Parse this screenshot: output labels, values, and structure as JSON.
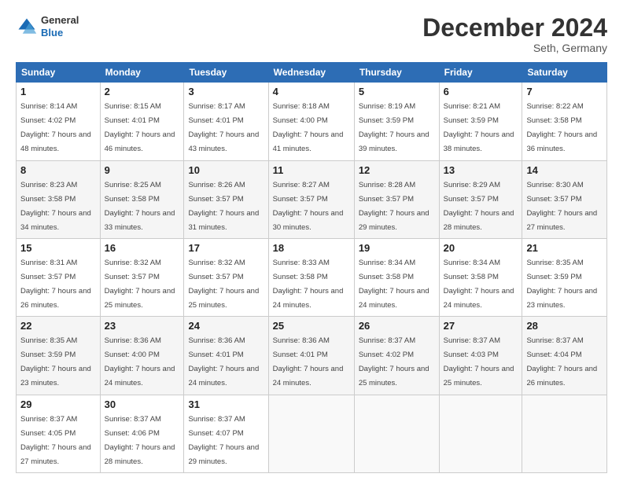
{
  "header": {
    "logo": {
      "general": "General",
      "blue": "Blue"
    },
    "month": "December 2024",
    "location": "Seth, Germany"
  },
  "weekdays": [
    "Sunday",
    "Monday",
    "Tuesday",
    "Wednesday",
    "Thursday",
    "Friday",
    "Saturday"
  ],
  "weeks": [
    [
      {
        "day": "1",
        "sunrise": "8:14 AM",
        "sunset": "4:02 PM",
        "daylight": "7 hours and 48 minutes."
      },
      {
        "day": "2",
        "sunrise": "8:15 AM",
        "sunset": "4:01 PM",
        "daylight": "7 hours and 46 minutes."
      },
      {
        "day": "3",
        "sunrise": "8:17 AM",
        "sunset": "4:01 PM",
        "daylight": "7 hours and 43 minutes."
      },
      {
        "day": "4",
        "sunrise": "8:18 AM",
        "sunset": "4:00 PM",
        "daylight": "7 hours and 41 minutes."
      },
      {
        "day": "5",
        "sunrise": "8:19 AM",
        "sunset": "3:59 PM",
        "daylight": "7 hours and 39 minutes."
      },
      {
        "day": "6",
        "sunrise": "8:21 AM",
        "sunset": "3:59 PM",
        "daylight": "7 hours and 38 minutes."
      },
      {
        "day": "7",
        "sunrise": "8:22 AM",
        "sunset": "3:58 PM",
        "daylight": "7 hours and 36 minutes."
      }
    ],
    [
      {
        "day": "8",
        "sunrise": "8:23 AM",
        "sunset": "3:58 PM",
        "daylight": "7 hours and 34 minutes."
      },
      {
        "day": "9",
        "sunrise": "8:25 AM",
        "sunset": "3:58 PM",
        "daylight": "7 hours and 33 minutes."
      },
      {
        "day": "10",
        "sunrise": "8:26 AM",
        "sunset": "3:57 PM",
        "daylight": "7 hours and 31 minutes."
      },
      {
        "day": "11",
        "sunrise": "8:27 AM",
        "sunset": "3:57 PM",
        "daylight": "7 hours and 30 minutes."
      },
      {
        "day": "12",
        "sunrise": "8:28 AM",
        "sunset": "3:57 PM",
        "daylight": "7 hours and 29 minutes."
      },
      {
        "day": "13",
        "sunrise": "8:29 AM",
        "sunset": "3:57 PM",
        "daylight": "7 hours and 28 minutes."
      },
      {
        "day": "14",
        "sunrise": "8:30 AM",
        "sunset": "3:57 PM",
        "daylight": "7 hours and 27 minutes."
      }
    ],
    [
      {
        "day": "15",
        "sunrise": "8:31 AM",
        "sunset": "3:57 PM",
        "daylight": "7 hours and 26 minutes."
      },
      {
        "day": "16",
        "sunrise": "8:32 AM",
        "sunset": "3:57 PM",
        "daylight": "7 hours and 25 minutes."
      },
      {
        "day": "17",
        "sunrise": "8:32 AM",
        "sunset": "3:57 PM",
        "daylight": "7 hours and 25 minutes."
      },
      {
        "day": "18",
        "sunrise": "8:33 AM",
        "sunset": "3:58 PM",
        "daylight": "7 hours and 24 minutes."
      },
      {
        "day": "19",
        "sunrise": "8:34 AM",
        "sunset": "3:58 PM",
        "daylight": "7 hours and 24 minutes."
      },
      {
        "day": "20",
        "sunrise": "8:34 AM",
        "sunset": "3:58 PM",
        "daylight": "7 hours and 24 minutes."
      },
      {
        "day": "21",
        "sunrise": "8:35 AM",
        "sunset": "3:59 PM",
        "daylight": "7 hours and 23 minutes."
      }
    ],
    [
      {
        "day": "22",
        "sunrise": "8:35 AM",
        "sunset": "3:59 PM",
        "daylight": "7 hours and 23 minutes."
      },
      {
        "day": "23",
        "sunrise": "8:36 AM",
        "sunset": "4:00 PM",
        "daylight": "7 hours and 24 minutes."
      },
      {
        "day": "24",
        "sunrise": "8:36 AM",
        "sunset": "4:01 PM",
        "daylight": "7 hours and 24 minutes."
      },
      {
        "day": "25",
        "sunrise": "8:36 AM",
        "sunset": "4:01 PM",
        "daylight": "7 hours and 24 minutes."
      },
      {
        "day": "26",
        "sunrise": "8:37 AM",
        "sunset": "4:02 PM",
        "daylight": "7 hours and 25 minutes."
      },
      {
        "day": "27",
        "sunrise": "8:37 AM",
        "sunset": "4:03 PM",
        "daylight": "7 hours and 25 minutes."
      },
      {
        "day": "28",
        "sunrise": "8:37 AM",
        "sunset": "4:04 PM",
        "daylight": "7 hours and 26 minutes."
      }
    ],
    [
      {
        "day": "29",
        "sunrise": "8:37 AM",
        "sunset": "4:05 PM",
        "daylight": "7 hours and 27 minutes."
      },
      {
        "day": "30",
        "sunrise": "8:37 AM",
        "sunset": "4:06 PM",
        "daylight": "7 hours and 28 minutes."
      },
      {
        "day": "31",
        "sunrise": "8:37 AM",
        "sunset": "4:07 PM",
        "daylight": "7 hours and 29 minutes."
      },
      null,
      null,
      null,
      null
    ]
  ]
}
